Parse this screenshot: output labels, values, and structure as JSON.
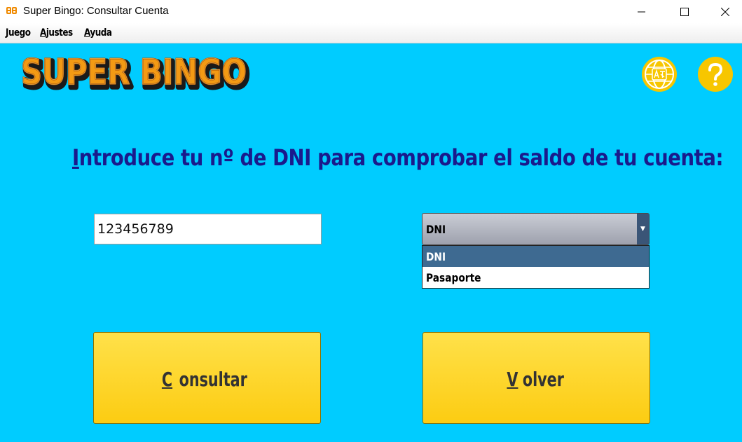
{
  "window": {
    "title": "Super Bingo: Consultar Cuenta",
    "minimize_icon": "minimize-icon",
    "maximize_icon": "maximize-icon",
    "close_icon": "close-icon"
  },
  "menu": {
    "items": [
      {
        "accel": "J",
        "rest": "uego"
      },
      {
        "accel": "A",
        "rest": "justes"
      },
      {
        "accel": "A",
        "rest": "yuda"
      }
    ]
  },
  "logo": {
    "text": "SUPER BINGO"
  },
  "icons": {
    "language": "language-globe-icon",
    "help": "help-question-icon"
  },
  "prompt": {
    "accel": "I",
    "rest": "ntroduce tu nº de DNI para comprobar el saldo de tu cuenta:"
  },
  "document_input": {
    "value": "123456789"
  },
  "document_type": {
    "selected": "DNI",
    "options": [
      "DNI",
      "Pasaporte"
    ]
  },
  "buttons": {
    "consultar": {
      "accel": "C",
      "rest": "onsultar"
    },
    "volver": {
      "accel": "V",
      "rest": "olver"
    }
  },
  "colors": {
    "background": "#00ccff",
    "accent_yellow": "#fccc12",
    "prompt_text": "#1a1a8c",
    "selected_option": "#3e6a91"
  }
}
